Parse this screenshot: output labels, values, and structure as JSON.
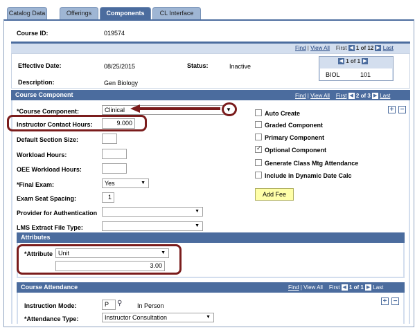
{
  "tabs": [
    {
      "label": "Catalog Data",
      "ul": "D"
    },
    {
      "label": "Offerings",
      "ul": "O"
    },
    {
      "label": "Components",
      "ul": ""
    },
    {
      "label": "CL Interface",
      "ul": "C"
    }
  ],
  "header": {
    "course_id_label": "Course ID:",
    "course_id": "019574"
  },
  "nav_top": {
    "find": "Find",
    "view_all": "View All",
    "first": "First",
    "count": "1 of 12",
    "last": "Last"
  },
  "effective": {
    "effective_date_label": "Effective Date:",
    "effective_date": "08/25/2015",
    "status_label": "Status:",
    "status": "Inactive",
    "description_label": "Description:",
    "description": "Gen Biology",
    "mini_count": "1 of 1",
    "subject": "BIOL",
    "catalog": "101"
  },
  "course_component": {
    "title": "Course Component",
    "nav": {
      "find": "Find",
      "view_all": "View All",
      "first": "First",
      "count": "2 of 3",
      "last": "Last"
    },
    "component_label": "*Course Component:",
    "component_value": "Clinical",
    "contact_hours_label": "Instructor Contact Hours:",
    "contact_hours": "9.000",
    "default_section_label": "Default Section Size:",
    "workload_label": "Workload Hours:",
    "oee_workload_label": "OEE Workload Hours:",
    "final_exam_label": "*Final Exam:",
    "final_exam_value": "Yes",
    "seat_spacing_label": "Exam Seat Spacing:",
    "seat_spacing": "1",
    "provider_label": "Provider for Authentication",
    "lms_label": "LMS Extract File Type:",
    "checkboxes": [
      {
        "label": "Auto Create",
        "checked": false
      },
      {
        "label": "Graded Component",
        "checked": false
      },
      {
        "label": "Primary Component",
        "checked": false
      },
      {
        "label": "Optional Component",
        "checked": true
      },
      {
        "label": "Generate Class Mtg Attendance",
        "checked": false
      },
      {
        "label": "Include in Dynamic Date Calc",
        "checked": false
      }
    ],
    "add_fee": "Add Fee"
  },
  "attributes": {
    "title": "Attributes",
    "attribute_label": "*Attribute",
    "attribute_value": "Unit",
    "attribute_amount": "3.00"
  },
  "attendance": {
    "title": "Course Attendance",
    "nav": {
      "find": "Find",
      "view_all": "View All",
      "first": "First",
      "count": "1 of 1",
      "last": "Last"
    },
    "mode_label": "Instruction Mode:",
    "mode_code": "P",
    "mode_desc": "In Person",
    "type_label": "*Attendance Type:",
    "type_value": "Instructor Consultation"
  },
  "colors": {
    "header_blue": "#4b6c9e",
    "light_blue": "#d3deee",
    "callout": "#7a1c1c",
    "button_yellow": "#ffffa8"
  }
}
